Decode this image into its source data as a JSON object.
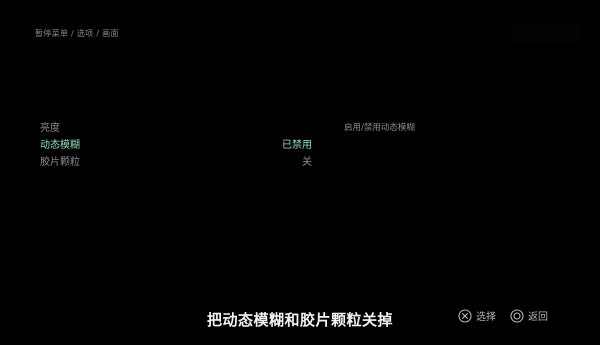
{
  "breadcrumb": "暂停菜单 / 选项 / 画面",
  "menu": {
    "items": [
      {
        "label": "亮度",
        "value": ""
      },
      {
        "label": "动态模糊",
        "value": "已禁用"
      },
      {
        "label": "胶片颗粒",
        "value": "关"
      }
    ]
  },
  "description": "启用/禁用动态模糊",
  "subtitle": "把动态模糊和胶片颗粒关掉",
  "prompts": {
    "select_label": "选择",
    "back_label": "返回"
  },
  "colors": {
    "background": "#000000",
    "selected": "#8fe0b8",
    "text": "#8c8c8c",
    "subtitle": "#f2f2f2"
  }
}
